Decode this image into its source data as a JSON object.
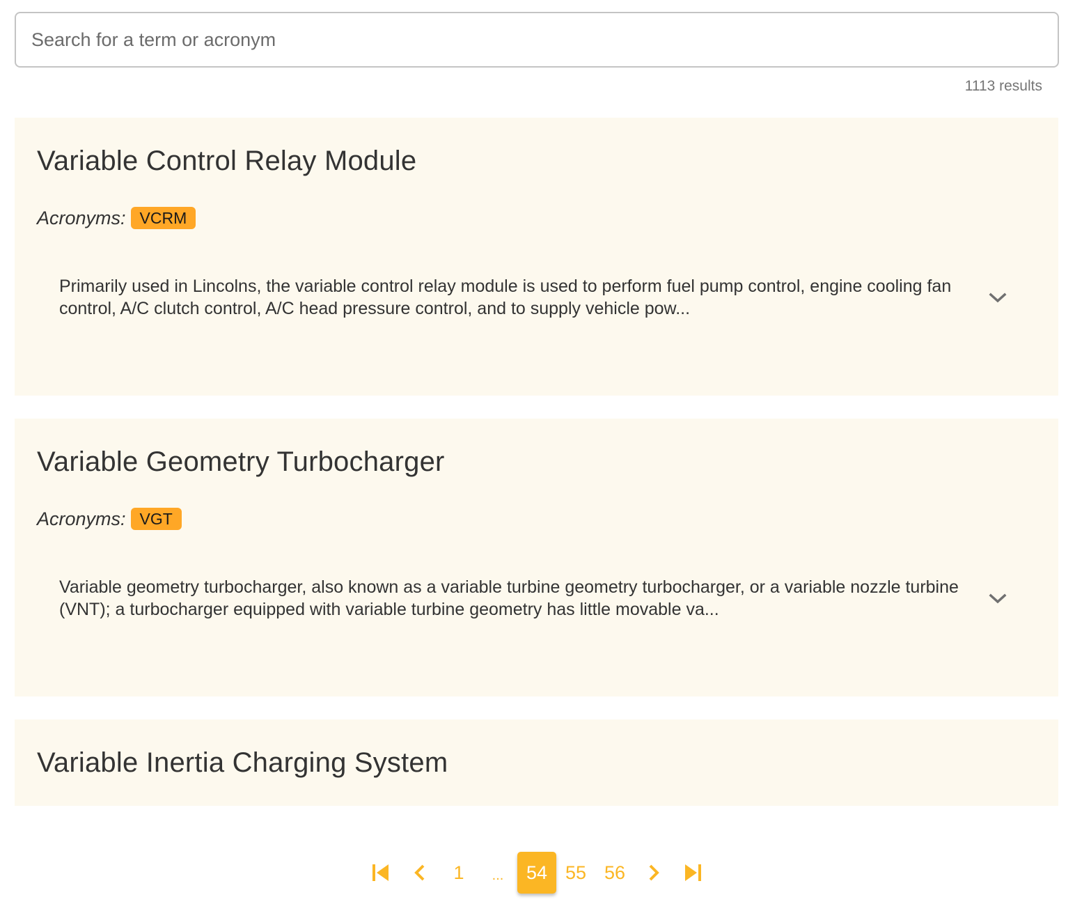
{
  "search": {
    "placeholder": "Search for a term or acronym",
    "value": ""
  },
  "results_count": "1113 results",
  "acronyms_label": "Acronyms:",
  "results": [
    {
      "title": "Variable Control Relay Module",
      "acronyms": [
        "VCRM"
      ],
      "definition": "Primarily used in Lincolns, the variable control relay module is used to perform fuel pump control, engine cooling fan control, A/C clutch control, A/C head pressure control, and to supply vehicle pow...",
      "expand_icon": "chevron-down-icon"
    },
    {
      "title": "Variable Geometry Turbocharger",
      "acronyms": [
        "VGT"
      ],
      "definition": "Variable geometry turbocharger, also known as a variable turbine geometry turbocharger, or a variable nozzle turbine (VNT); a turbocharger equipped with variable turbine geometry has little movable va...",
      "expand_icon": "chevron-down-icon"
    },
    {
      "title": "Variable Inertia Charging System"
    }
  ],
  "pagination": {
    "first_icon": "first-page-icon",
    "prev_icon": "chevron-left-icon",
    "pages": [
      "1",
      "...",
      "54",
      "55",
      "56"
    ],
    "current_page": "54",
    "next_icon": "chevron-right-icon",
    "last_icon": "last-page-icon"
  },
  "colors": {
    "accent": "#fbb624",
    "badge": "#ffa726",
    "card_background": "#fdf9ee",
    "text": "#333333"
  }
}
